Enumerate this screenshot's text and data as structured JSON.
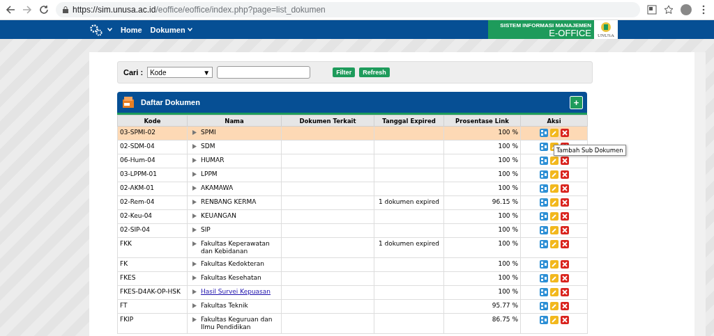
{
  "browser": {
    "url_host": "https://sim.unusa.ac.id",
    "url_path": "/eoffice/eoffice/index.php?page=list_dokumen"
  },
  "navbar": {
    "items": [
      {
        "label": "Home",
        "dropdown": false
      },
      {
        "label": "Dokumen",
        "dropdown": true
      }
    ],
    "brand_line1": "SISTEM INFORMASI MANAJEMEN",
    "brand_line2": "E-OFFICE",
    "logo_text": "UNUSA"
  },
  "search": {
    "label": "Cari :",
    "select_value": "Kode",
    "select_arrow": "▼",
    "buttons": [
      "Filter",
      "Refresh"
    ]
  },
  "panel": {
    "title": "Daftar Dokumen",
    "add_button": "+"
  },
  "table": {
    "columns": [
      "Kode",
      "Nama",
      "Dokumen Terkait",
      "Tanggal Expired",
      "Prosentase Link",
      "Aksi"
    ],
    "rows": [
      {
        "kode": "03-SPMI-02",
        "nama": "SPMI",
        "link": false,
        "terkait": "",
        "expired": "",
        "persen": "100 %",
        "selected": true
      },
      {
        "kode": "02-SDM-04",
        "nama": "SDM",
        "link": false,
        "terkait": "",
        "expired": "",
        "persen": "100 %",
        "selected": false
      },
      {
        "kode": "06-Hum-04",
        "nama": "HUMAR",
        "link": false,
        "terkait": "",
        "expired": "",
        "persen": "100 %",
        "selected": false
      },
      {
        "kode": "03-LPPM-01",
        "nama": "LPPM",
        "link": false,
        "terkait": "",
        "expired": "",
        "persen": "100 %",
        "selected": false
      },
      {
        "kode": "02-AKM-01",
        "nama": "AKAMAWA",
        "link": false,
        "terkait": "",
        "expired": "",
        "persen": "100 %",
        "selected": false
      },
      {
        "kode": "02-Rem-04",
        "nama": "RENBANG KERMA",
        "link": false,
        "terkait": "",
        "expired": "1 dokumen expired",
        "persen": "96.15 %",
        "selected": false
      },
      {
        "kode": "02-Keu-04",
        "nama": "KEUANGAN",
        "link": false,
        "terkait": "",
        "expired": "",
        "persen": "100 %",
        "selected": false
      },
      {
        "kode": "02-SIP-04",
        "nama": "SIP",
        "link": false,
        "terkait": "",
        "expired": "",
        "persen": "100 %",
        "selected": false
      },
      {
        "kode": "FKK",
        "nama": "Fakultas Keperawatan dan Kebidanan",
        "link": false,
        "terkait": "",
        "expired": "1 dokumen expired",
        "persen": "100 %",
        "selected": false
      },
      {
        "kode": "FK",
        "nama": "Fakultas Kedokteran",
        "link": false,
        "terkait": "",
        "expired": "",
        "persen": "100 %",
        "selected": false
      },
      {
        "kode": "FKES",
        "nama": "Fakultas Kesehatan",
        "link": false,
        "terkait": "",
        "expired": "",
        "persen": "100 %",
        "selected": false
      },
      {
        "kode": "FKES-D4AK-OP-HSK",
        "nama": "Hasil Survei Kepuasan",
        "link": true,
        "terkait": "",
        "expired": "",
        "persen": "100 %",
        "selected": false
      },
      {
        "kode": "FT",
        "nama": "Fakultas Teknik",
        "link": false,
        "terkait": "",
        "expired": "",
        "persen": "95.77 %",
        "selected": false
      },
      {
        "kode": "FKIP",
        "nama": "Fakultas Keguruan dan Ilmu Pendidikan",
        "link": false,
        "terkait": "",
        "expired": "",
        "persen": "86.75 %",
        "selected": false
      }
    ]
  },
  "tooltip": "Tambah Sub Dokumen"
}
